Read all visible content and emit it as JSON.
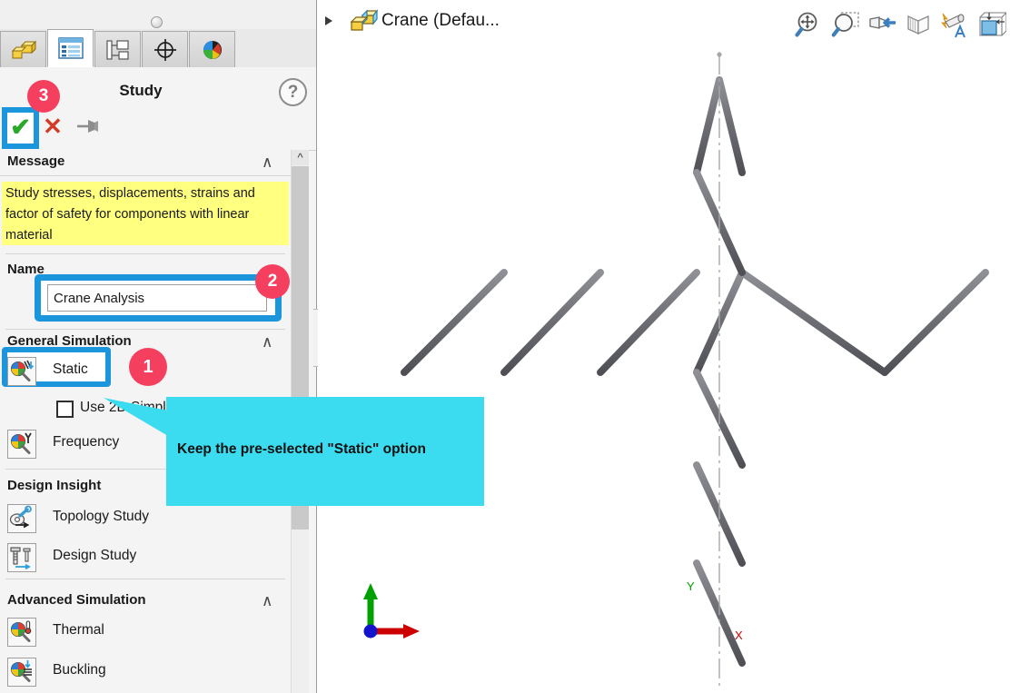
{
  "app": {
    "panel_title": "Study",
    "help_icon": "?"
  },
  "tabs": [
    {
      "name": "feature-manager",
      "icon": "feature-manager-icon"
    },
    {
      "name": "property-manager",
      "icon": "property-manager-icon",
      "selected": true
    },
    {
      "name": "configuration-manager",
      "icon": "configuration-manager-icon"
    },
    {
      "name": "dimxpert-manager",
      "icon": "dimxpert-icon"
    },
    {
      "name": "display-manager",
      "icon": "display-manager-icon"
    }
  ],
  "actions": {
    "ok_label": "✔",
    "cancel_label": "✕",
    "pin_label": "pin"
  },
  "message": {
    "header": "Message",
    "collapse_chevron": "∧",
    "text": "Study stresses, displacements, strains and factor of safety  for components with linear material"
  },
  "name": {
    "header": "Name",
    "value": "Crane Analysis",
    "placeholder": "Study name"
  },
  "general_simulation": {
    "header": "General Simulation",
    "collapse_chevron": "∧",
    "items": [
      {
        "label": "Static",
        "icon": "static-study-icon",
        "selected": true
      },
      {
        "label": "Frequency",
        "icon": "frequency-study-icon",
        "selected": false
      }
    ],
    "use_2d_simplification": {
      "label": "Use 2D Simplification",
      "checked": false
    }
  },
  "design_insight": {
    "header": "Design Insight",
    "items": [
      {
        "label": "Topology Study",
        "icon": "topology-study-icon"
      },
      {
        "label": "Design Study",
        "icon": "design-study-icon"
      }
    ]
  },
  "advanced_simulation": {
    "header": "Advanced Simulation",
    "collapse_chevron": "∧",
    "items": [
      {
        "label": "Thermal",
        "icon": "thermal-study-icon"
      },
      {
        "label": "Buckling",
        "icon": "buckling-study-icon"
      }
    ]
  },
  "document": {
    "title": "Crane  (Defau...",
    "expand_arrow": "▶",
    "icon": "assembly-icon"
  },
  "view_toolbar": [
    {
      "name": "zoom-to-fit-icon"
    },
    {
      "name": "zoom-to-area-icon"
    },
    {
      "name": "previous-view-icon"
    },
    {
      "name": "section-view-icon"
    },
    {
      "name": "view-orientation-icon"
    },
    {
      "name": "display-style-icon"
    }
  ],
  "callout": {
    "text": "Keep the pre-selected \"Static\" option",
    "color": "#3bdcf0"
  },
  "badges": [
    {
      "id": "1",
      "target": "static-option"
    },
    {
      "id": "2",
      "target": "name-input"
    },
    {
      "id": "3",
      "target": "ok-button"
    }
  ],
  "highlight_color": "#1b96dd",
  "badge_color": "#f43f5e",
  "triad": {
    "x_label": "X",
    "y_label": "Y",
    "x_color": "#cc0000",
    "y_color": "#00a000",
    "origin_color": "#1414cc"
  },
  "model": {
    "name": "crane-truss-wireframe",
    "member_color": "#6e7076"
  }
}
